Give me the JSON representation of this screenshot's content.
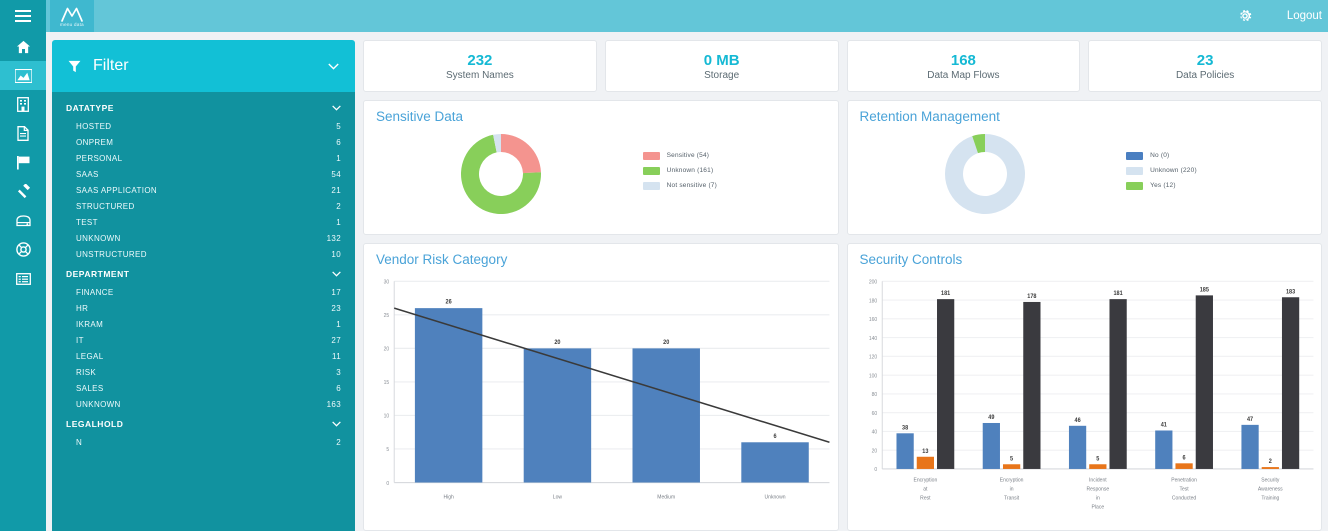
{
  "rail": {
    "menu_icon": "hamburger-icon",
    "items": [
      {
        "icon": "home-icon",
        "name": "home",
        "active": false
      },
      {
        "icon": "chart-area-icon",
        "name": "dashboard",
        "active": true
      },
      {
        "icon": "building-icon",
        "name": "organization",
        "active": false
      },
      {
        "icon": "document-icon",
        "name": "documents",
        "active": false
      },
      {
        "icon": "flag-icon",
        "name": "flags",
        "active": false
      },
      {
        "icon": "gavel-icon",
        "name": "legal",
        "active": false
      },
      {
        "icon": "server-icon",
        "name": "systems",
        "active": false
      },
      {
        "icon": "lifebuoy-icon",
        "name": "support",
        "active": false
      },
      {
        "icon": "list-icon",
        "name": "reports",
        "active": false
      }
    ]
  },
  "topbar": {
    "logo_text": "menu data",
    "gear_icon": "gear-icon",
    "logout_label": "Logout"
  },
  "filter": {
    "title": "Filter",
    "filter_icon": "funnel-icon",
    "chevron_icon": "chevron-down-icon",
    "groups": [
      {
        "title": "DATATYPE",
        "rows": [
          {
            "label": "HOSTED",
            "value": "5"
          },
          {
            "label": "ONPREM",
            "value": "6"
          },
          {
            "label": "PERSONAL",
            "value": "1"
          },
          {
            "label": "SAAS",
            "value": "54"
          },
          {
            "label": "SAAS APPLICATION",
            "value": "21"
          },
          {
            "label": "STRUCTURED",
            "value": "2"
          },
          {
            "label": "TEST",
            "value": "1"
          },
          {
            "label": "UNKNOWN",
            "value": "132"
          },
          {
            "label": "UNSTRUCTURED",
            "value": "10"
          }
        ]
      },
      {
        "title": "DEPARTMENT",
        "rows": [
          {
            "label": "FINANCE",
            "value": "17"
          },
          {
            "label": "HR",
            "value": "23"
          },
          {
            "label": "IKRAM",
            "value": "1"
          },
          {
            "label": "IT",
            "value": "27"
          },
          {
            "label": "LEGAL",
            "value": "11"
          },
          {
            "label": "RISK",
            "value": "3"
          },
          {
            "label": "SALES",
            "value": "6"
          },
          {
            "label": "UNKNOWN",
            "value": "163"
          }
        ]
      },
      {
        "title": "LEGALHOLD",
        "rows": [
          {
            "label": "N",
            "value": "2"
          }
        ]
      }
    ]
  },
  "kpis": [
    {
      "value": "232",
      "label": "System Names"
    },
    {
      "value": "0 MB",
      "label": "Storage"
    },
    {
      "value": "168",
      "label": "Data Map Flows"
    },
    {
      "value": "23",
      "label": "Data Policies"
    }
  ],
  "cards": {
    "sensitive_data": {
      "title": "Sensitive Data"
    },
    "retention": {
      "title": "Retention Management"
    },
    "vendor_risk": {
      "title": "Vendor Risk Category"
    },
    "security_controls": {
      "title": "Security Controls"
    }
  },
  "chart_data": [
    {
      "id": "sensitive-data",
      "type": "pie",
      "title": "Sensitive Data",
      "donut": true,
      "legend_position": "right",
      "labels": [
        "Sensitive (54)",
        "Unknown (161)",
        "Not sensitive (7)"
      ],
      "categories": [
        "Sensitive",
        "Unknown",
        "Not sensitive"
      ],
      "values": [
        54,
        161,
        7
      ],
      "colors": [
        "#f4948f",
        "#88cf5a",
        "#d5e3f0"
      ]
    },
    {
      "id": "retention-management",
      "type": "pie",
      "title": "Retention Management",
      "donut": true,
      "legend_position": "right",
      "labels": [
        "No (0)",
        "Unknown (220)",
        "Yes (12)"
      ],
      "categories": [
        "No",
        "Unknown",
        "Yes"
      ],
      "values": [
        0,
        220,
        12
      ],
      "colors": [
        "#4a7fc1",
        "#d5e3f0",
        "#88cf5a"
      ]
    },
    {
      "id": "vendor-risk-category",
      "type": "bar",
      "title": "Vendor Risk Category",
      "xlabel": "",
      "ylabel": "",
      "categories": [
        "High",
        "Low",
        "Medium",
        "Unknown"
      ],
      "values": [
        26,
        20,
        20,
        6
      ],
      "data_labels": [
        "26",
        "20",
        "20",
        "6"
      ],
      "ylim": [
        0,
        30
      ],
      "yticks": [
        0,
        5,
        10,
        15,
        20,
        25,
        30
      ],
      "grid": true,
      "bar_color": "#4f81bd",
      "trendline": {
        "show": true,
        "color": "#3a3a3a",
        "from": 26,
        "to": 6
      }
    },
    {
      "id": "security-controls",
      "type": "bar",
      "title": "Security Controls",
      "xlabel": "",
      "ylabel": "",
      "categories": [
        "Encryption at Rest",
        "Encryption in Transit",
        "Incident Response in Place",
        "Penetration Test Conducted",
        "Security Awareness Training"
      ],
      "category_lines": [
        [
          "Encryption",
          "at",
          "Rest"
        ],
        [
          "Encryption",
          "in",
          "Transit"
        ],
        [
          "Incident",
          "Response",
          "in",
          "Place"
        ],
        [
          "Penetration",
          "Test",
          "Conducted"
        ],
        [
          "Security",
          "Awareness",
          "Training"
        ]
      ],
      "series": [
        {
          "name": "series-1",
          "color": "#4f81bd",
          "values": [
            38,
            49,
            46,
            41,
            47
          ]
        },
        {
          "name": "series-2",
          "color": "#e8751a",
          "values": [
            13,
            5,
            5,
            6,
            2
          ]
        },
        {
          "name": "series-3",
          "color": "#3a3a3f",
          "values": [
            181,
            178,
            181,
            185,
            183
          ]
        }
      ],
      "ylim": [
        0,
        200
      ],
      "yticks": [
        0,
        20,
        40,
        60,
        80,
        100,
        120,
        140,
        160,
        180,
        200
      ],
      "grid": true
    }
  ]
}
